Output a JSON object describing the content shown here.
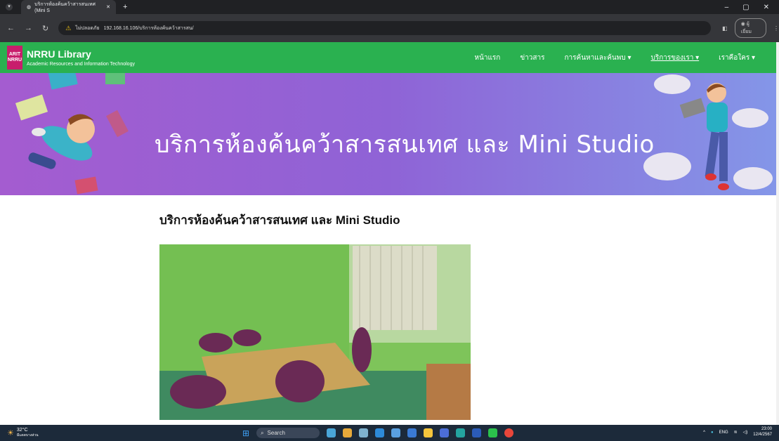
{
  "browser": {
    "tab_title": "บริการห้องค้นคว้าสารสนเทศ (Mini S",
    "tab_close": "✕",
    "new_tab": "+",
    "window_controls": [
      "–",
      "▢",
      "✕"
    ],
    "security_label": "ไม่ปลอดภัย",
    "url": "192.168.16.106/บริการห้องค้นคว้าสารสน/",
    "profile_label": "ผู้เยี่ยม"
  },
  "site": {
    "logo_lines": [
      "ARIT",
      "NRRU"
    ],
    "brand_name": "NRRU Library",
    "brand_sub": "Academic Resources and Information Technology",
    "menu": [
      {
        "label": "หน้าแรก",
        "active": false
      },
      {
        "label": "ข่าวสาร",
        "active": false
      },
      {
        "label": "การค้นหาและค้นพบ ▾",
        "active": false
      },
      {
        "label": "บริการของเรา ▾",
        "active": true
      },
      {
        "label": "เราคือใคร ▾",
        "active": false
      }
    ]
  },
  "banner": {
    "title": "บริการห้องค้นคว้าสารสนเทศ และ Mini Studio"
  },
  "main": {
    "heading": "บริการห้องค้นคว้าสารสนเทศ และ Mini Studio"
  },
  "taskbar": {
    "temperature": "32°C",
    "weather_note": "มีแดดบางส่วน",
    "search_placeholder": "Search",
    "language": "ENG",
    "time": "23:00",
    "date": "12/4/2567"
  }
}
